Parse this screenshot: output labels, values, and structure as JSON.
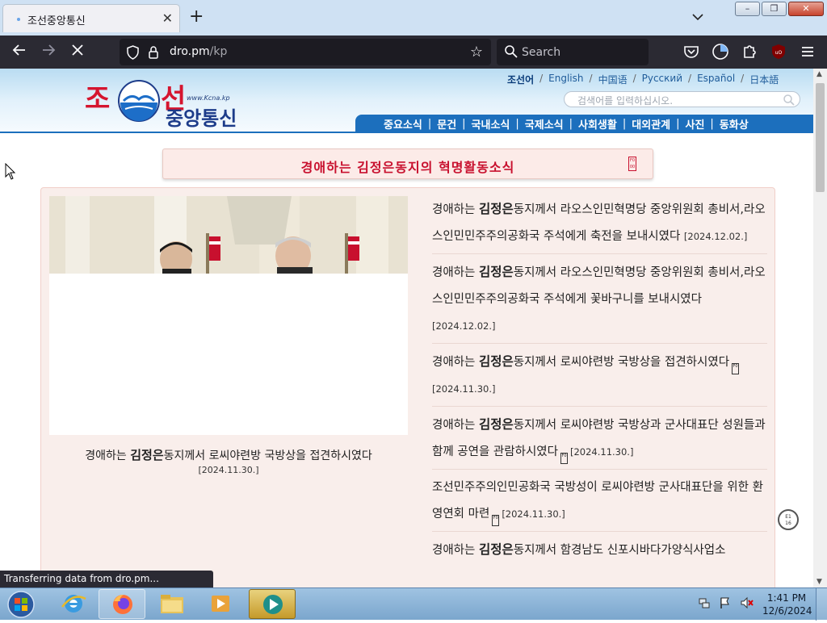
{
  "browser": {
    "tab_title": "조선중앙통신",
    "new_tab_label": "+",
    "url_host": "dro.pm",
    "url_path": "/kp",
    "search_placeholder": "Search",
    "status_text": "Transferring data from dro.pm...",
    "window_buttons": [
      "–",
      "❐",
      "✕"
    ]
  },
  "site": {
    "logo_line1_a": "조",
    "logo_line1_b": "선",
    "logo_www": "www.Kcna.kp",
    "logo_line2": "중앙통신",
    "languages": [
      "조선어",
      "English",
      "中国语",
      "Русский",
      "Español",
      "日本語"
    ],
    "search_placeholder": "검색어를 입력하십시오.",
    "menu": [
      "중요소식",
      "문건",
      "국내소식",
      "국제소식",
      "사회생활",
      "대외관계",
      "사진",
      "동화상"
    ],
    "banner": "경애하는 김정은동지의 혁명활동소식",
    "featured": {
      "caption_pre": "경애하는 ",
      "caption_name": "김정은",
      "caption_post": "동지께서 로씨야련방 국방상을 접견하시였다",
      "date": "[2024.11.30.]"
    },
    "news": [
      {
        "pre": "경애하는 ",
        "name": "김정은",
        "post": "동지께서 라오스인민혁명당 중앙위원회 총비서,라오스인민민주주의공화국 주석에게 축전을 보내시였다",
        "date": "[2024.12.02.]"
      },
      {
        "pre": "경애하는 ",
        "name": "김정은",
        "post": "동지께서 라오스인민혁명당 중앙위원회 총비서,라오스인민민주주의공화국 주석에게 꽃바구니를 보내시였다",
        "date": "[2024.12.02.]"
      },
      {
        "pre": "경애하는 ",
        "name": "김정은",
        "post": "동지께서 로씨야련방 국방상을 접견하시였다",
        "date": "[2024.11.30.]"
      },
      {
        "pre": "경애하는 ",
        "name": "김정은",
        "post": "동지께서 로씨야련방 국방상과 군사대표단 성원들과 함께 공연을 관람하시였다",
        "date": "[2024.11.30.]"
      },
      {
        "pre": "",
        "name": "",
        "post": "조선민주주의인민공화국 국방성이 로씨야련방 군사대표단을 위한 환영연회 마련",
        "date": "[2024.11.30.]"
      },
      {
        "pre": "경애하는 ",
        "name": "김정은",
        "post": "동지께서 함경남도 신포시바다가양식사업소",
        "date": ""
      }
    ]
  },
  "taskbar": {
    "time": "1:41 PM",
    "date": "12/6/2024"
  },
  "colors": {
    "accent_blue": "#1c6fbd",
    "brand_red": "#d5152f",
    "panel_bg": "#f9eeeb"
  }
}
